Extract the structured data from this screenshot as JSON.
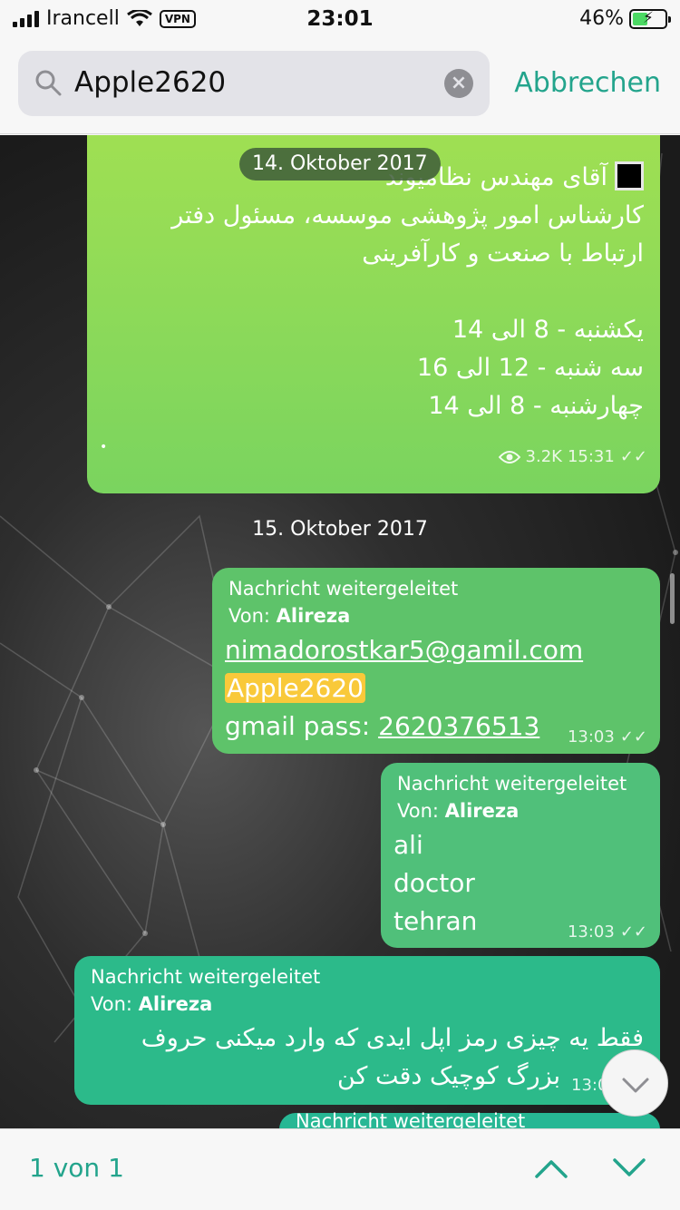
{
  "status_bar": {
    "carrier": "Irancell",
    "vpn": "VPN",
    "time": "23:01",
    "battery": "46%"
  },
  "search": {
    "query": "Apple2620",
    "cancel_label": "Abbrechen"
  },
  "messages": [
    {
      "date": "14. Oktober 2017",
      "title": "آقای مهندس نظامیوند",
      "line1": "کارشناس امور پژوهشی موسسه، مسئول دفتر",
      "line2": "ارتباط با صنعت و کارآفرینی",
      "schedule": [
        "یکشنبه   -   8  الی 14",
        "سه شنبه   -   12  الی 16",
        "چهارشنبه   -   8 الی 14"
      ],
      "dot": "•",
      "views": "3.2K",
      "time": "15:31"
    },
    {
      "date": "15. Oktober 2017",
      "forwarded": "Nachricht weitergeleitet",
      "from_label": "Von:",
      "from_name": "Alireza",
      "email": "nimadorostkar5@gamil.com",
      "highlight": "Apple2620",
      "pass_label": "gmail pass:",
      "pass_value": "2620376513",
      "time": "13:03"
    },
    {
      "forwarded": "Nachricht weitergeleitet",
      "from_label": "Von:",
      "from_name": "Alireza",
      "lines": [
        "ali",
        "doctor",
        "tehran"
      ],
      "time": "13:03"
    },
    {
      "forwarded": "Nachricht weitergeleitet",
      "from_label": "Von:",
      "from_name": "Alireza",
      "line1": "فقط یه چیزی رمز اپل ایدی  که وارد میکنی حروف",
      "line2": "بزرگ کوچیک دقت کن",
      "time": "13:0"
    },
    {
      "forwarded": "Nachricht weitergeleitet"
    }
  ],
  "footer": {
    "result_count": "1 von 1"
  },
  "colors": {
    "accent": "#23a48c",
    "highlight": "#f9c93a"
  }
}
